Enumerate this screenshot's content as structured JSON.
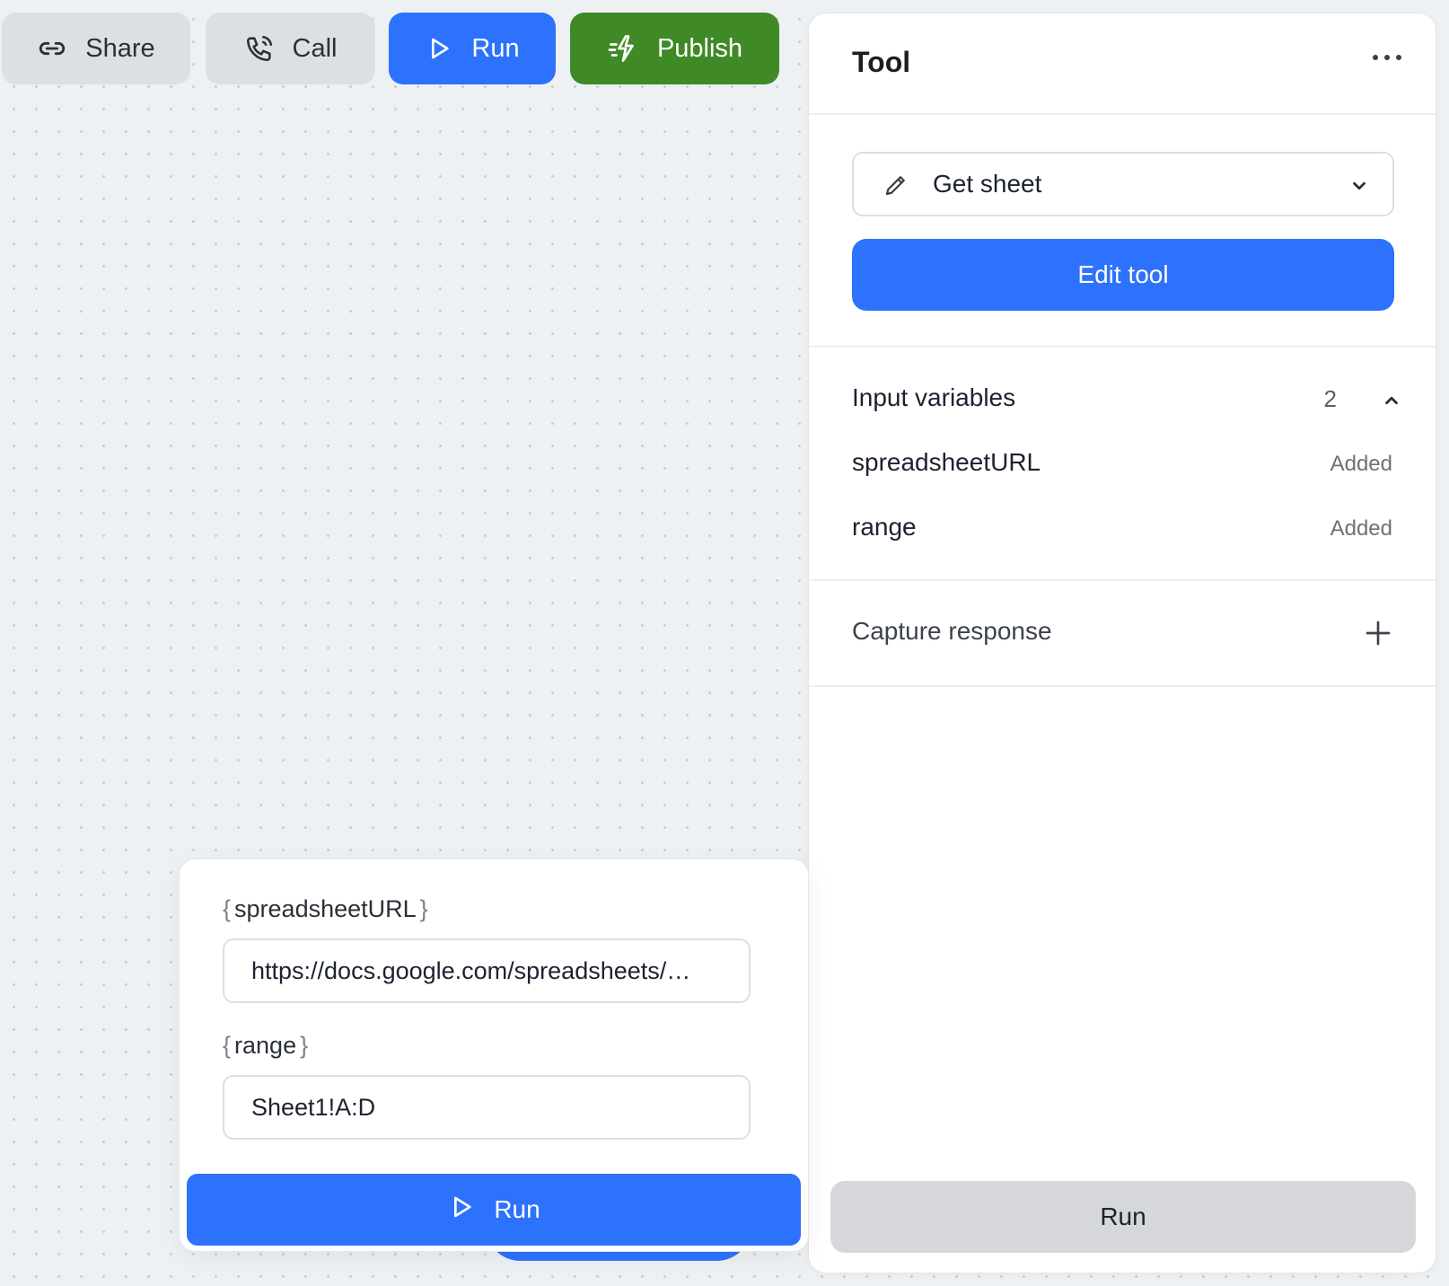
{
  "toolbar": {
    "share_label": "Share",
    "call_label": "Call",
    "run_label": "Run",
    "publish_label": "Publish",
    "icons": [
      "link-icon",
      "phone-icon",
      "play-icon",
      "lightning-icon"
    ]
  },
  "panel": {
    "title": "Tool",
    "tool_select_value": "Get sheet",
    "edit_tool_label": "Edit tool",
    "input_variables": {
      "title": "Input variables",
      "count": "2",
      "items": [
        {
          "name": "spreadsheetURL",
          "status": "Added"
        },
        {
          "name": "range",
          "status": "Added"
        }
      ]
    },
    "capture_response_label": "Capture response",
    "run_label": "Run"
  },
  "run_card": {
    "fields": [
      {
        "name": "spreadsheetURL",
        "value": "https://docs.google.com/spreadsheets/…"
      },
      {
        "name": "range",
        "value": "Sheet1!A:D"
      }
    ],
    "brace_open": "{",
    "brace_close": "}",
    "run_label": "Run"
  },
  "colors": {
    "primary_blue": "#2d72fc",
    "publish_green": "#3f8a27",
    "neutral_button": "#dde0e3",
    "disabled_run": "#d5d7da"
  }
}
